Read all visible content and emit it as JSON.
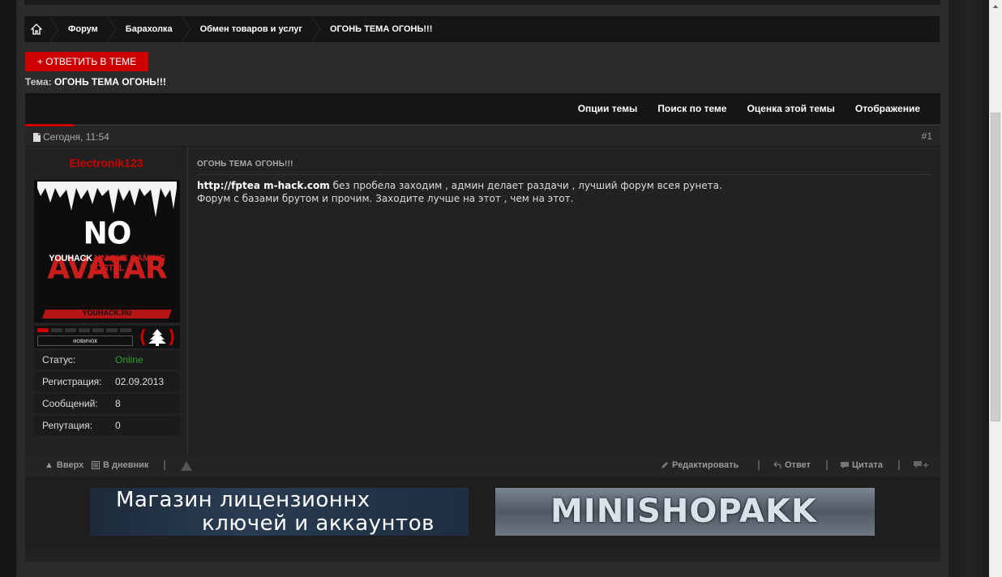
{
  "breadcrumbs": [
    "Форум",
    "Барахолка",
    "Обмен товаров и услуг",
    "ОГОНЬ ТЕМА ОГОНЬ!!!"
  ],
  "reply_button": "+ ОТВЕТИТЬ В ТЕМЕ",
  "topic": {
    "label": "Тема:",
    "title": "ОГОНЬ ТЕМА ОГОНЬ!!!"
  },
  "toolbar": [
    "Опции темы",
    "Поиск по теме",
    "Оценка этой темы",
    "Отображение"
  ],
  "post": {
    "date": "Сегодня, 11:54",
    "number": "#1",
    "title": "ОГОНЬ ТЕМА ОГОНЬ!!!",
    "link_text": "http://fptea m-hack.com",
    "line1_rest": " без пробела заходим , админ делает раздачи , лучший форум всея рунета.",
    "line2": "Форум с базами брутом и прочим. Заходите лучше на этот , чем на этот."
  },
  "user": {
    "name": "Electronik123",
    "avatar": {
      "line1a": "NO",
      "line1b": "AVATAR",
      "line2a": "YOUHACK",
      "line2b": "UNIQUE GAMING PORTAL",
      "site": "YOUHACK.RU"
    },
    "rank": "новичок",
    "rank_level": 1,
    "stats": [
      {
        "k": "Статус:",
        "v": "Online"
      },
      {
        "k": "Регистрация:",
        "v": "02.09.2013"
      },
      {
        "k": "Сообщений:",
        "v": "8"
      },
      {
        "k": "Репутация:",
        "v": "0"
      }
    ]
  },
  "footer_actions": {
    "up": "Вверх",
    "diary": "В дневник",
    "edit": "Редактировать",
    "reply": "Ответ",
    "quote": "Цитата"
  },
  "ads": {
    "ad1": {
      "line1": "Магазин лицензионнх",
      "line2": "ключей и аккаунтов"
    },
    "ad2": {
      "text": "MINISHOPAKK"
    }
  },
  "colors": {
    "accent": "#cc0000",
    "online": "#2e9f2e"
  }
}
